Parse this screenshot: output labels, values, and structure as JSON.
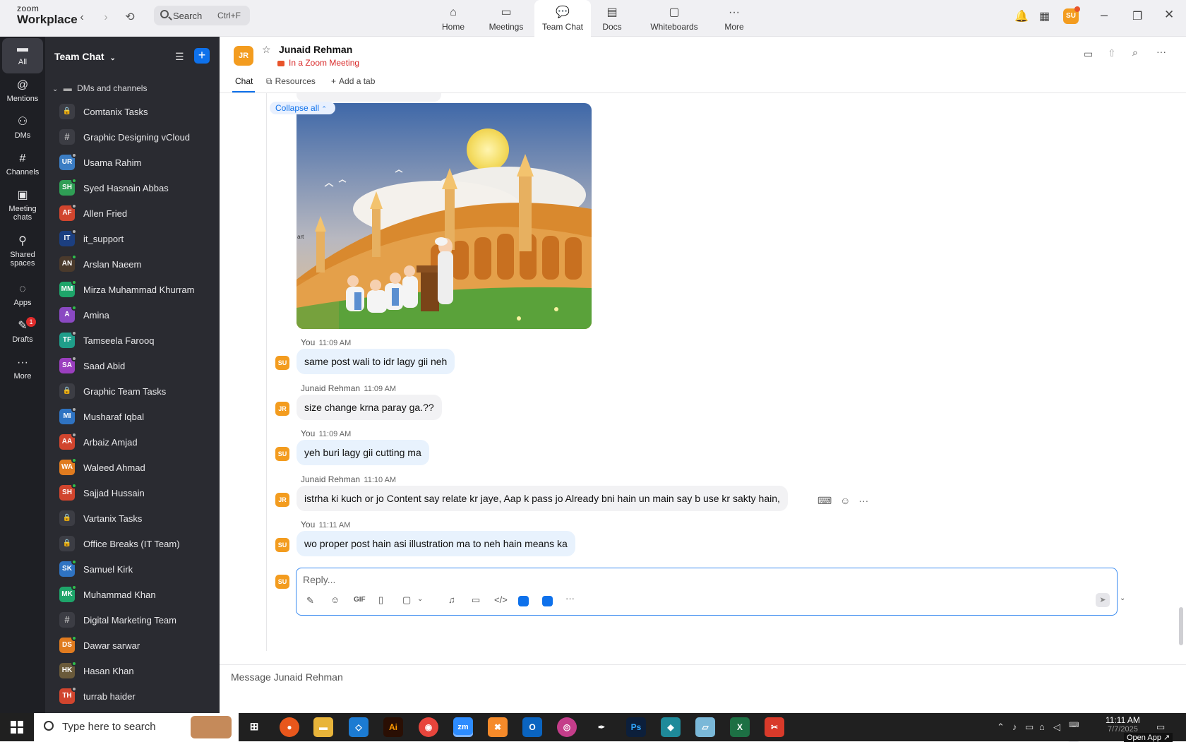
{
  "app": {
    "brand_top": "zoom",
    "brand_bottom": "Workplace"
  },
  "topbar": {
    "search_label": "Search",
    "search_shortcut": "Ctrl+F",
    "tabs": [
      {
        "label": "Home",
        "icon": "home-icon"
      },
      {
        "label": "Meetings",
        "icon": "video-camera-icon"
      },
      {
        "label": "Team Chat",
        "icon": "chat-bubbles-icon",
        "active": true
      },
      {
        "label": "Docs",
        "icon": "document-icon"
      },
      {
        "label": "Whiteboards",
        "icon": "whiteboard-icon"
      },
      {
        "label": "More",
        "icon": "ellipsis-icon"
      }
    ],
    "user_initials": "SU"
  },
  "rail": [
    {
      "label": "All",
      "icon": "chat-icon",
      "active": true
    },
    {
      "label": "Mentions",
      "icon": "at-sign-icon"
    },
    {
      "label": "DMs",
      "icon": "people-icon"
    },
    {
      "label": "Channels",
      "icon": "hash-icon"
    },
    {
      "label": "Meeting chats",
      "icon": "calendar-icon"
    },
    {
      "label": "Shared spaces",
      "icon": "shared-spaces-icon"
    },
    {
      "label": "Apps",
      "icon": "apps-icon"
    },
    {
      "label": "Drafts",
      "icon": "drafts-icon",
      "badge": "1"
    },
    {
      "label": "More",
      "icon": "ellipsis-icon"
    }
  ],
  "sidebar": {
    "title": "Team Chat",
    "section": "DMs and channels",
    "items": [
      {
        "name": "Comtanix Tasks",
        "type": "lock"
      },
      {
        "name": "Graphic Designing vCloud",
        "type": "hash"
      },
      {
        "name": "Usama Rahim",
        "initials": "UR",
        "color": "#3b7dc4",
        "status": "#b0b0b0"
      },
      {
        "name": "Syed Hasnain Abbas",
        "initials": "SH",
        "color": "#2f9e55",
        "status": "#2fbf4b"
      },
      {
        "name": "Allen Fried",
        "initials": "AF",
        "color": "#d1452e",
        "status": "#b0b0b0"
      },
      {
        "name": "it_support",
        "initials": "IT",
        "color": "#1c3f80",
        "status": "#b0b0b0"
      },
      {
        "name": "Arslan Naeem",
        "initials": "AN",
        "color": "#4a3a2c",
        "status": "#2fbf4b"
      },
      {
        "name": "Mirza Muhammad Khurram",
        "initials": "MM",
        "color": "#1ea56a",
        "status": "#2fbf4b"
      },
      {
        "name": "Amina",
        "initials": "A",
        "color": "#8a49c2",
        "status": "#2fbf4b"
      },
      {
        "name": "Tamseela Farooq",
        "initials": "TF",
        "color": "#1f9e8a",
        "status": "#b0b0b0"
      },
      {
        "name": "Saad Abid",
        "initials": "SA",
        "color": "#9b3fbf",
        "status": "#b0b0b0"
      },
      {
        "name": "Graphic Team Tasks",
        "type": "lock"
      },
      {
        "name": "Musharaf Iqbal",
        "initials": "MI",
        "color": "#2f73c2",
        "status": "#b0b0b0"
      },
      {
        "name": "Arbaiz Amjad",
        "initials": "AA",
        "color": "#d1452e",
        "status": "#b0b0b0"
      },
      {
        "name": "Waleed Ahmad",
        "initials": "WA",
        "color": "#e07b1f",
        "status": "#2fbf4b"
      },
      {
        "name": "Sajjad Hussain",
        "initials": "SH",
        "color": "#d1452e",
        "status": "#2fbf4b"
      },
      {
        "name": "Vartanix Tasks",
        "type": "lock"
      },
      {
        "name": "Office Breaks (IT Team)",
        "type": "lock"
      },
      {
        "name": "Samuel Kirk",
        "initials": "SK",
        "color": "#2f73c2",
        "status": "#2fbf4b"
      },
      {
        "name": "Muhammad Khan",
        "initials": "MK",
        "color": "#1ea56a",
        "status": "#2fbf4b"
      },
      {
        "name": "Digital Marketing Team",
        "type": "hash"
      },
      {
        "name": "Dawar sarwar",
        "initials": "DS",
        "color": "#e07b1f",
        "status": "#2fbf4b"
      },
      {
        "name": "Hasan Khan",
        "initials": "HK",
        "color": "#6a5a3a",
        "status": "#2fbf4b"
      },
      {
        "name": "turrab haider",
        "initials": "TH",
        "color": "#d1452e",
        "status": "#b0b0b0"
      }
    ]
  },
  "chat": {
    "contact_initials": "JR",
    "contact_name": "Junaid Rehman",
    "contact_status": "In a Zoom Meeting",
    "tabs": [
      "Chat",
      "Resources",
      "Add a tab"
    ],
    "collapse_label": "Collapse all",
    "image_caption_fragment": "art",
    "messages": [
      {
        "sender": "You",
        "time": "11:09 AM",
        "initials": "SU",
        "text": "same post wali to idr lagy gii neh",
        "mine": true
      },
      {
        "sender": "Junaid Rehman",
        "time": "11:09 AM",
        "initials": "JR",
        "text": "size change krna paray ga.??",
        "mine": false
      },
      {
        "sender": "You",
        "time": "11:09 AM",
        "initials": "SU",
        "text": "yeh buri lagy gii cutting ma",
        "mine": true
      },
      {
        "sender": "Junaid Rehman",
        "time": "11:10 AM",
        "initials": "JR",
        "text": "istrha ki kuch or jo Content say relate kr jaye, Aap k pass jo Already bni hain un main say b use kr sakty hain,",
        "mine": false
      },
      {
        "sender": "You",
        "time": "11:11 AM",
        "initials": "SU",
        "text": "wo proper post hain asi illustration ma to neh hain means ka",
        "mine": true
      }
    ],
    "reply_placeholder": "Reply...",
    "compose_placeholder": "Message Junaid Rehman",
    "gif_label": "GIF"
  },
  "taskbar": {
    "search_placeholder": "Type here to search",
    "time": "11:11 AM",
    "date": "7/7/2025",
    "open_app": "Open App"
  }
}
